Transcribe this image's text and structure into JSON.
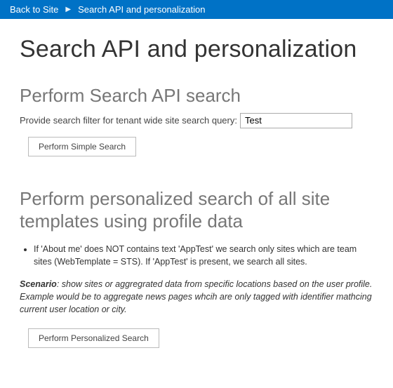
{
  "topbar": {
    "back_label": "Back to Site",
    "breadcrumb_current": "Search API and personalization"
  },
  "page": {
    "title": "Search API and personalization"
  },
  "section_simple": {
    "heading": "Perform Search API search",
    "filter_label": "Provide search filter for tenant wide site search query:",
    "filter_value": "Test",
    "button_label": "Perform Simple Search"
  },
  "section_personalized": {
    "heading": "Perform personalized search of all site templates using profile data",
    "bullet_1": "If 'About me' does NOT contains text 'AppTest' we search only sites which are team sites (WebTemplate = STS). If 'AppTest' is present, we search all sites.",
    "scenario_lead": "Scenario",
    "scenario_text": ": show sites or aggregrated data from specific locations based on the user profile. Example would be to aggregate news pages whcih are only tagged with identifier mathcing current user location or city.",
    "button_label": "Perform Personalized Search"
  }
}
